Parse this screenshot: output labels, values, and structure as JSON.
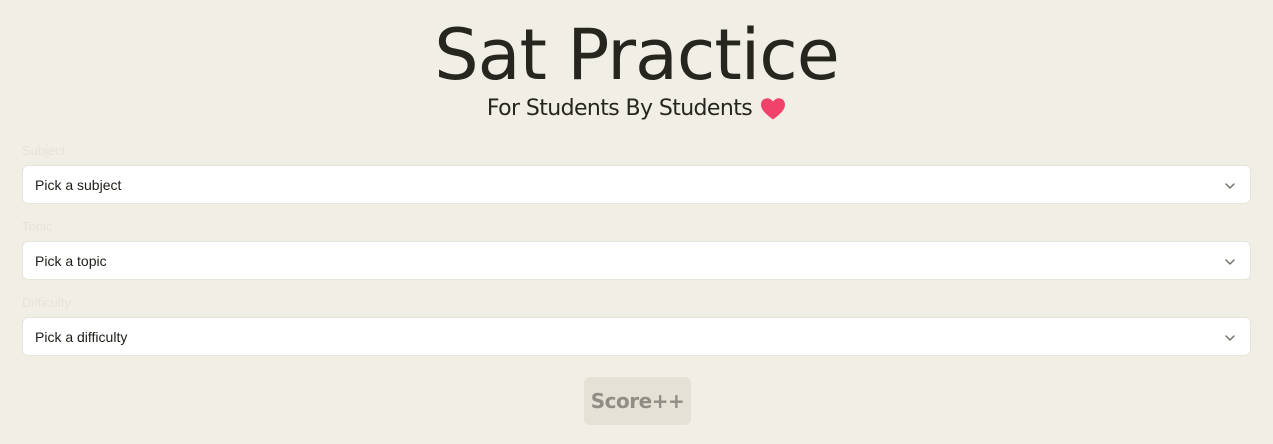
{
  "header": {
    "title": "Sat Practice",
    "subtitle": "For Students By Students",
    "heart_icon": "heart-icon",
    "heart_color": "#f0426b"
  },
  "form": {
    "subject": {
      "label": "Subject",
      "value": "Pick a subject"
    },
    "topic": {
      "label": "Topic",
      "value": "Pick a topic"
    },
    "difficulty": {
      "label": "Difficulty",
      "value": "Pick a difficulty"
    },
    "chevron_icon": "chevron-down-icon",
    "submit_label": "Score++"
  },
  "colors": {
    "background": "#f1eee6",
    "text": "#27261e",
    "button_bg": "#e4e1d6",
    "button_text": "#908d85"
  }
}
